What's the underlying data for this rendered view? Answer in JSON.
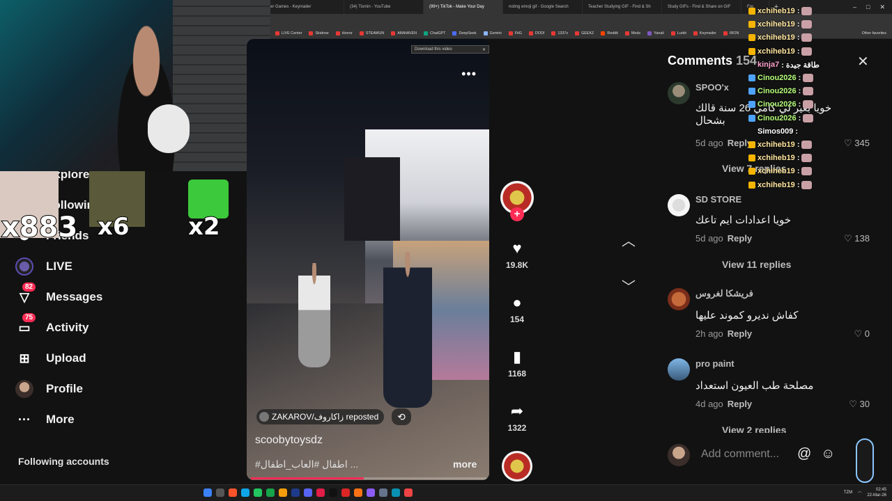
{
  "browser": {
    "tabs": [
      {
        "label": "er Games - Keymailer",
        "active": false
      },
      {
        "label": "(34) Tismin - YouTube",
        "active": false
      },
      {
        "label": "(99+) TikTok - Make Your Day",
        "active": true
      },
      {
        "label": "noting emoji gif - Google Search",
        "active": false
      },
      {
        "label": "Teacher Studying GIF - Find & Sh",
        "active": false
      },
      {
        "label": "Study GIFs - Find & Share on GIF",
        "active": false
      },
      {
        "label": "Fre",
        "active": false
      }
    ],
    "new_tab": "+",
    "bookmarks": [
      "LIVE Center",
      "Skidrow",
      "Horror",
      "STEAMUN",
      "AIMHAVEN",
      "ChatGPT",
      "DeepSeek",
      "Gemini",
      "FitG",
      "DODI",
      "1337x",
      "GEEKZ",
      "Reddit",
      "Mods",
      "Yanali",
      "Lurkit",
      "Keymailer",
      "IRON"
    ],
    "other_favorites": "Other favorites",
    "download_bar": "Download this video"
  },
  "alerts": {
    "cat_multiplier": "x883",
    "b_multiplier": "x6",
    "g_multiplier": "x2"
  },
  "sidebar": {
    "items": [
      {
        "label": "Explore",
        "icon": "compass-icon",
        "badge": ""
      },
      {
        "label": "Following",
        "icon": "following-icon",
        "badge": ""
      },
      {
        "label": "Friends",
        "icon": "friends-icon",
        "badge": ""
      },
      {
        "label": "LIVE",
        "icon": "live-avatar",
        "badge": ""
      },
      {
        "label": "Messages",
        "icon": "messages-icon",
        "badge": "82"
      },
      {
        "label": "Activity",
        "icon": "activity-icon",
        "badge": "75"
      },
      {
        "label": "Upload",
        "icon": "upload-icon",
        "badge": ""
      },
      {
        "label": "Profile",
        "icon": "profile-avatar",
        "badge": ""
      },
      {
        "label": "More",
        "icon": "more-icon",
        "badge": ""
      }
    ],
    "following_accounts": "Following accounts"
  },
  "video": {
    "reposted_by": "ZAKAROV/زاكاروف reposted",
    "author": "scoobytoysdz",
    "caption": "#اطفال #العاب_اطفال ...",
    "more": "more",
    "progress": 0.48
  },
  "actions": {
    "likes": "19.8K",
    "comments": "154",
    "saves": "1168",
    "shares": "1322"
  },
  "comments": {
    "title": "Comments",
    "count": "154",
    "items": [
      {
        "user": "SPOO'x",
        "text": "خويا بغير لي كامي 26 سنة قالك بشحال",
        "time": "5d ago",
        "reply": "Reply",
        "likes": "345"
      },
      {
        "user": "SD STORE",
        "text": "خويا اعدادات ايم تاعك",
        "time": "5d ago",
        "reply": "Reply",
        "likes": "138"
      },
      {
        "user": "فريشكا لغروس",
        "text": "كفاش نديرو كموند عليها",
        "time": "2h ago",
        "reply": "Reply",
        "likes": "0"
      },
      {
        "user": "pro paint",
        "text": "مصلحة طب العيون استعداد",
        "time": "4d ago",
        "reply": "Reply",
        "likes": "30"
      }
    ],
    "view_replies": [
      "View 7 replies",
      "View 11 replies",
      "View 2 replies"
    ],
    "add_placeholder": "Add comment...",
    "mention": "@",
    "emoji": "☺"
  },
  "chat": [
    {
      "name": "xchiheb19",
      "msg": ":",
      "kind": "x"
    },
    {
      "name": "xchiheb19",
      "msg": ":",
      "kind": "x"
    },
    {
      "name": "xchiheb19",
      "msg": ":",
      "kind": "x"
    },
    {
      "name": "xchiheb19",
      "msg": ":",
      "kind": "x"
    },
    {
      "name": "kinja7",
      "msg": ": طاقة جيدة",
      "kind": "k"
    },
    {
      "name": "Cinou2026",
      "msg": ":",
      "kind": "c"
    },
    {
      "name": "Cinou2026",
      "msg": ":",
      "kind": "c"
    },
    {
      "name": "Cinou2026",
      "msg": ":",
      "kind": "c"
    },
    {
      "name": "Cinou2026",
      "msg": ":",
      "kind": "c"
    },
    {
      "name": "Simos009",
      "msg": ":",
      "kind": "s"
    },
    {
      "name": "xchiheb19",
      "msg": ":",
      "kind": "x"
    },
    {
      "name": "xchiheb19",
      "msg": ":",
      "kind": "x"
    },
    {
      "name": "xchiheb19",
      "msg": ":",
      "kind": "x"
    },
    {
      "name": "xchiheb19",
      "msg": ":",
      "kind": "x"
    }
  ],
  "taskbar": {
    "lang": "TZM",
    "time": "02:45",
    "date": "22-Mar-26"
  },
  "colors": {
    "accent": "#fe2c55",
    "panel": "#121212",
    "chrome": "#353535"
  }
}
